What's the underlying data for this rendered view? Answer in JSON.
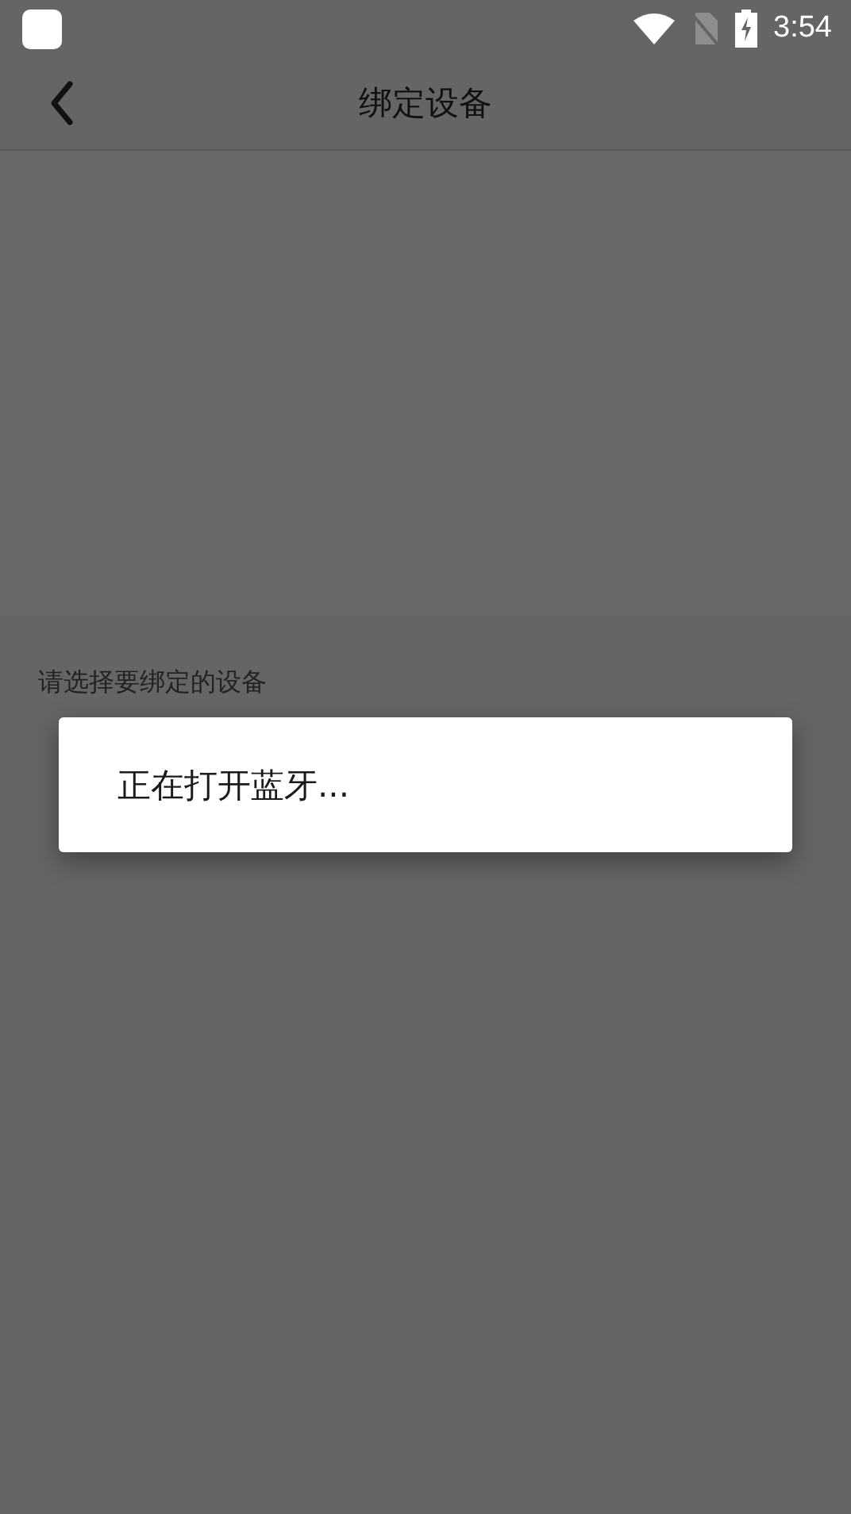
{
  "status_bar": {
    "time": "3:54"
  },
  "header": {
    "title": "绑定设备"
  },
  "section": {
    "label": "请选择要绑定的设备"
  },
  "dialog": {
    "message": "正在打开蓝牙..."
  }
}
